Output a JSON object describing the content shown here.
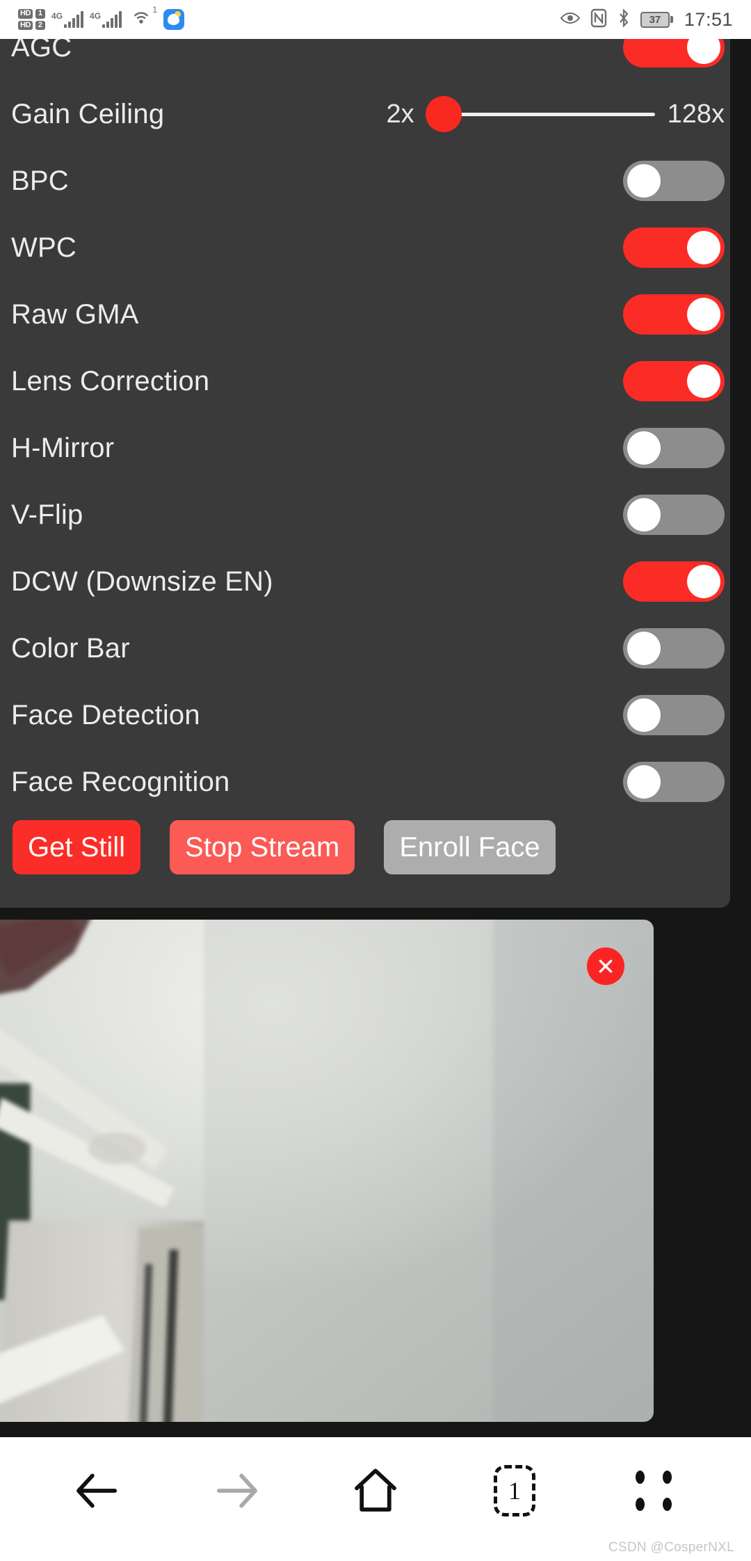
{
  "status_bar": {
    "hd_labels": [
      "HD",
      "HD"
    ],
    "sim_numbers": [
      "1",
      "2"
    ],
    "network_labels": [
      "4G",
      "4G"
    ],
    "hotspot_superscript": "1",
    "app_icon_name": "weather-app-icon",
    "right_icons": [
      "eye-icon",
      "nfc-icon",
      "bluetooth-icon"
    ],
    "battery_percent": "37",
    "clock": "17:51"
  },
  "panel": {
    "background_color": "#3a3a3a",
    "rows": [
      {
        "label": "AGC",
        "control": "toggle",
        "state": "on",
        "clipped": true
      },
      {
        "label": "Gain Ceiling",
        "control": "slider",
        "min_label": "2x",
        "max_label": "128x",
        "value": "2x"
      },
      {
        "label": "BPC",
        "control": "toggle",
        "state": "off"
      },
      {
        "label": "WPC",
        "control": "toggle",
        "state": "on"
      },
      {
        "label": "Raw GMA",
        "control": "toggle",
        "state": "on"
      },
      {
        "label": "Lens Correction",
        "control": "toggle",
        "state": "on"
      },
      {
        "label": "H-Mirror",
        "control": "toggle",
        "state": "off"
      },
      {
        "label": "V-Flip",
        "control": "toggle",
        "state": "off"
      },
      {
        "label": "DCW (Downsize EN)",
        "control": "toggle",
        "state": "on"
      },
      {
        "label": "Color Bar",
        "control": "toggle",
        "state": "off"
      },
      {
        "label": "Face Detection",
        "control": "toggle",
        "state": "off"
      },
      {
        "label": "Face Recognition",
        "control": "toggle",
        "state": "off"
      }
    ],
    "buttons": [
      {
        "label": "Get Still",
        "style": "btn-still",
        "color": "#fb2d28"
      },
      {
        "label": "Stop Stream",
        "style": "btn-stream",
        "color": "#fb5a55"
      },
      {
        "label": "Enroll Face",
        "style": "btn-enroll",
        "color": "#adadad"
      }
    ]
  },
  "stream": {
    "name": "camera-stream",
    "close_button_color": "#fb2424",
    "description": "blurry camera view of a white wall and appliance"
  },
  "nav_bar": {
    "items": [
      {
        "name": "back-arrow-icon",
        "label": "Back",
        "enabled": true
      },
      {
        "name": "forward-arrow-icon",
        "label": "Forward",
        "enabled": false
      },
      {
        "name": "home-icon",
        "label": "Home",
        "enabled": true
      },
      {
        "name": "tabs-icon",
        "label": "Tabs",
        "count": "1",
        "enabled": true
      },
      {
        "name": "more-menu-icon",
        "label": "More",
        "enabled": true
      }
    ]
  },
  "watermark": {
    "text": "CSDN @CosperNXL"
  }
}
